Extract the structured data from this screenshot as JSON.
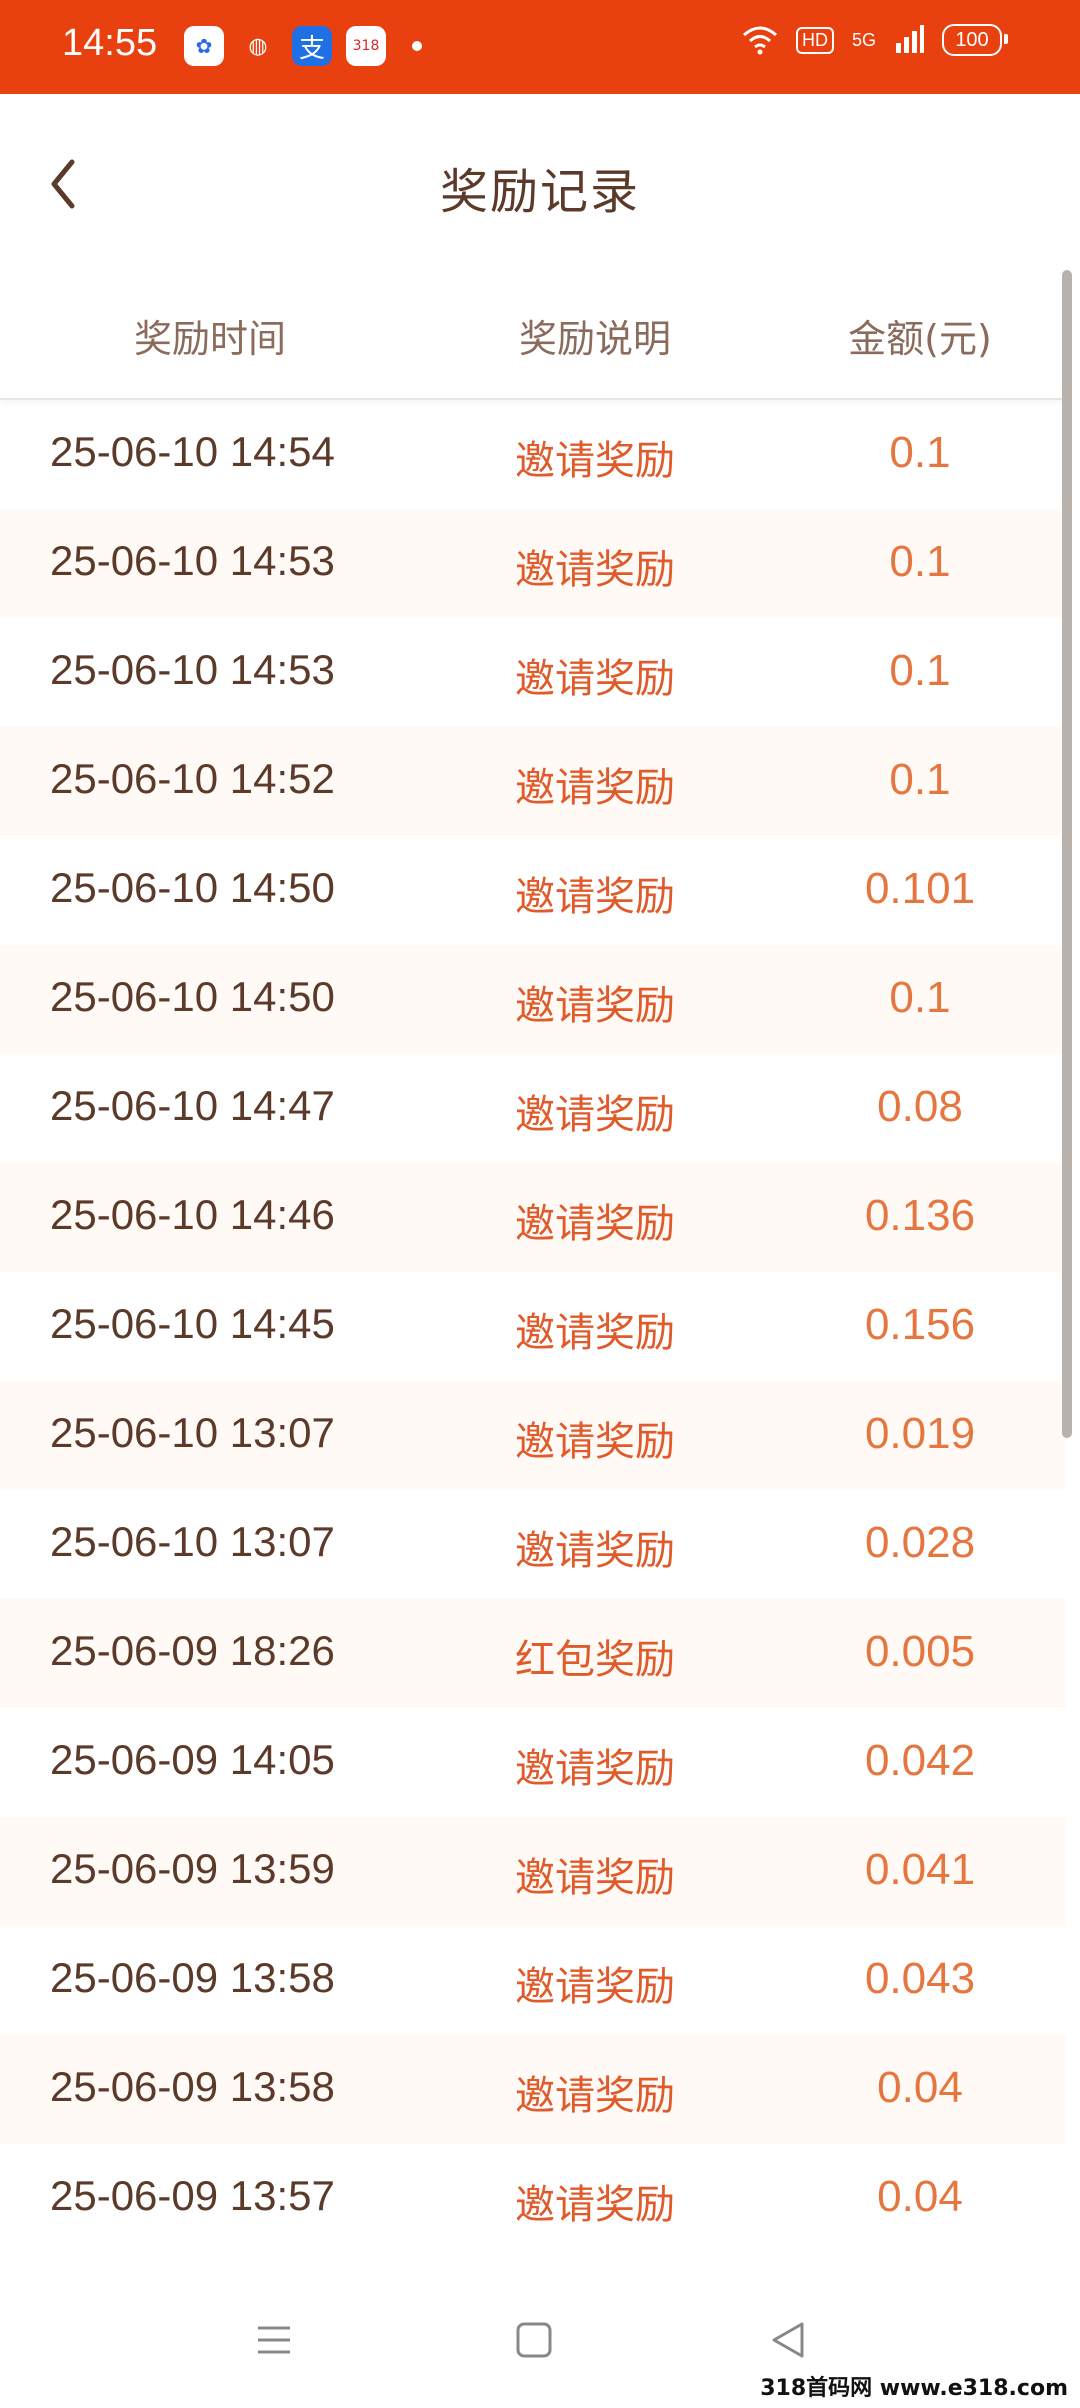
{
  "status_bar": {
    "time": "14:55",
    "apps": [
      {
        "icon": "baidu-app-icon",
        "text": "✿"
      },
      {
        "icon": "wechat-app-icon",
        "text": "◍"
      },
      {
        "icon": "alipay-app-icon",
        "text": "支"
      },
      {
        "icon": "318-app-icon",
        "text": "318"
      }
    ],
    "hd": "HD",
    "network": "5G",
    "battery": "100"
  },
  "header": {
    "title": "奖励记录",
    "back_icon": "chevron-left-icon"
  },
  "table": {
    "columns": [
      "奖励时间",
      "奖励说明",
      "金额(元)"
    ],
    "rows": [
      {
        "time": "25-06-10 14:54",
        "desc": "邀请奖励",
        "amount": "0.1"
      },
      {
        "time": "25-06-10 14:53",
        "desc": "邀请奖励",
        "amount": "0.1"
      },
      {
        "time": "25-06-10 14:53",
        "desc": "邀请奖励",
        "amount": "0.1"
      },
      {
        "time": "25-06-10 14:52",
        "desc": "邀请奖励",
        "amount": "0.1"
      },
      {
        "time": "25-06-10 14:50",
        "desc": "邀请奖励",
        "amount": "0.101"
      },
      {
        "time": "25-06-10 14:50",
        "desc": "邀请奖励",
        "amount": "0.1"
      },
      {
        "time": "25-06-10 14:47",
        "desc": "邀请奖励",
        "amount": "0.08"
      },
      {
        "time": "25-06-10 14:46",
        "desc": "邀请奖励",
        "amount": "0.136"
      },
      {
        "time": "25-06-10 14:45",
        "desc": "邀请奖励",
        "amount": "0.156"
      },
      {
        "time": "25-06-10 13:07",
        "desc": "邀请奖励",
        "amount": "0.019"
      },
      {
        "time": "25-06-10 13:07",
        "desc": "邀请奖励",
        "amount": "0.028"
      },
      {
        "time": "25-06-09 18:26",
        "desc": "红包奖励",
        "amount": "0.005"
      },
      {
        "time": "25-06-09 14:05",
        "desc": "邀请奖励",
        "amount": "0.042"
      },
      {
        "time": "25-06-09 13:59",
        "desc": "邀请奖励",
        "amount": "0.041"
      },
      {
        "time": "25-06-09 13:58",
        "desc": "邀请奖励",
        "amount": "0.043"
      },
      {
        "time": "25-06-09 13:58",
        "desc": "邀请奖励",
        "amount": "0.04"
      },
      {
        "time": "25-06-09 13:57",
        "desc": "邀请奖励",
        "amount": "0.04"
      }
    ]
  },
  "nav_bar": {
    "buttons": [
      "menu-icon",
      "home-square-icon",
      "back-triangle-icon"
    ]
  },
  "watermark": "318首码网 www.e318.com",
  "colors": {
    "status_bar": "#e8410f",
    "title_text": "#5b3a2a",
    "desc_text": "#e05a2a",
    "amount_text": "#e6763f",
    "row_alt": "#fffaf6"
  }
}
